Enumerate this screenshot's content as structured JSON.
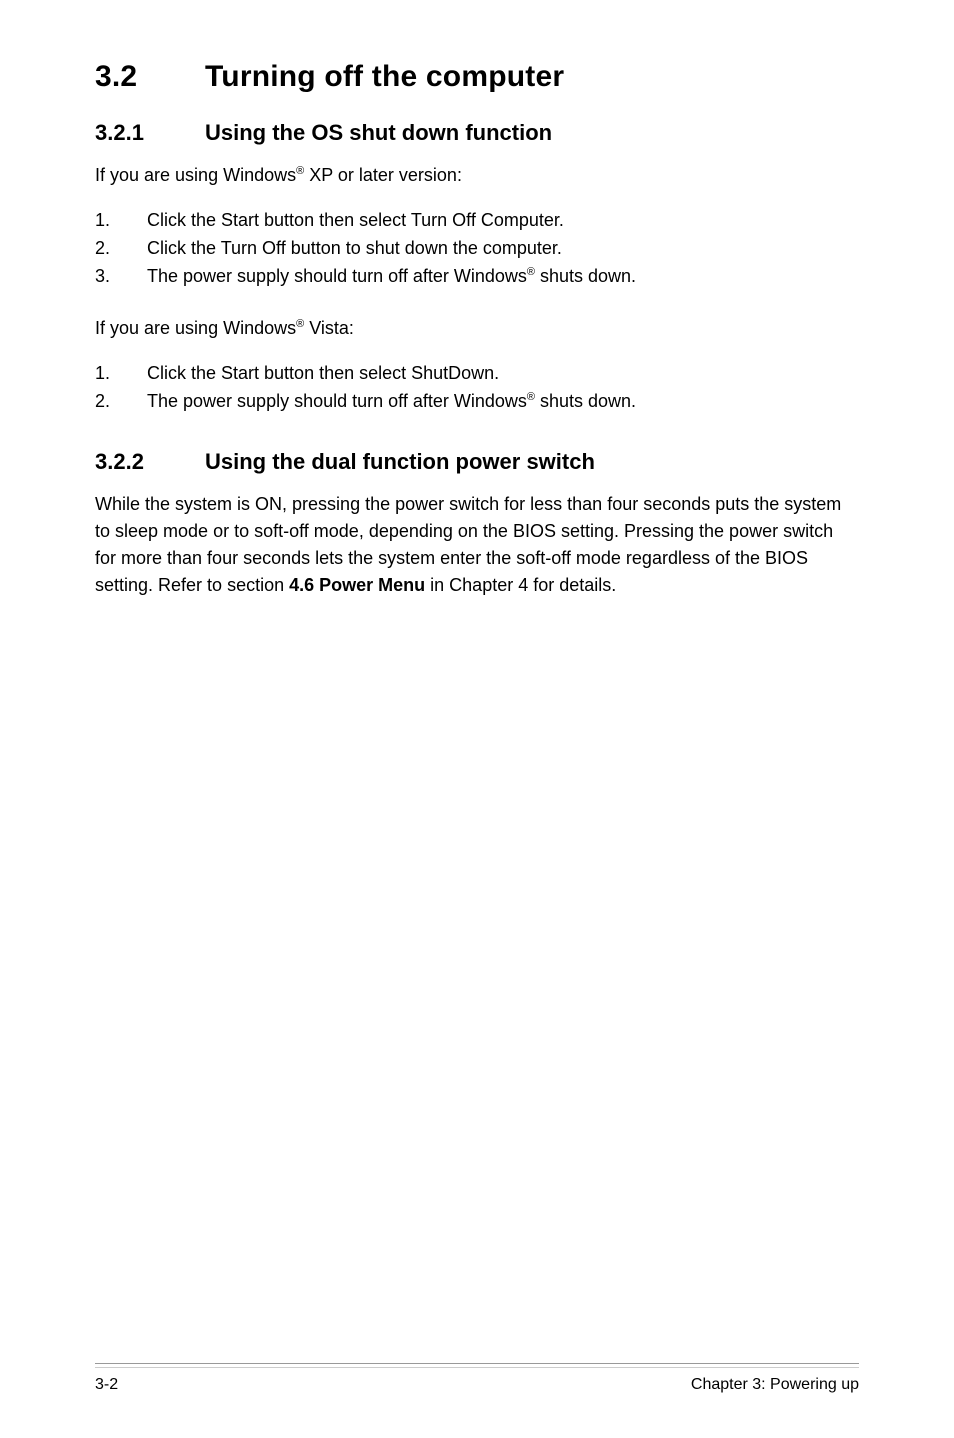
{
  "section": {
    "num": "3.2",
    "title": "Turning off the computer"
  },
  "sub1": {
    "num": "3.2.1",
    "title": "Using the OS shut down function",
    "intro_pre": "If you are using Windows",
    "intro_sup": "®",
    "intro_post": " XP or later version:",
    "steps_a": {
      "s1": {
        "n": "1.",
        "t": "Click the Start button then select Turn Off Computer."
      },
      "s2": {
        "n": "2.",
        "t": "Click the Turn Off button to shut down the computer."
      },
      "s3": {
        "n": "3.",
        "pre": "The power supply should turn off after Windows",
        "sup": "®",
        "post": " shuts down."
      }
    },
    "intro2_pre": "If you are using Windows",
    "intro2_sup": "®",
    "intro2_post": " Vista:",
    "steps_b": {
      "s1": {
        "n": "1.",
        "t": "Click the Start button then select ShutDown."
      },
      "s2": {
        "n": "2.",
        "pre": "The power supply should turn off after Windows",
        "sup": "®",
        "post": " shuts down."
      }
    }
  },
  "sub2": {
    "num": "3.2.2",
    "title": "Using the dual function power switch",
    "para_pre": "While the system is ON, pressing the power switch for less than four seconds puts the system to sleep mode or to soft-off mode, depending on the BIOS setting. Pressing the power switch for more than four seconds lets the system enter the soft-off mode regardless of the BIOS setting. Refer to section ",
    "para_bold": "4.6 Power Menu",
    "para_post": " in Chapter 4 for details."
  },
  "footer": {
    "left": "3-2",
    "right": "Chapter 3: Powering up"
  }
}
